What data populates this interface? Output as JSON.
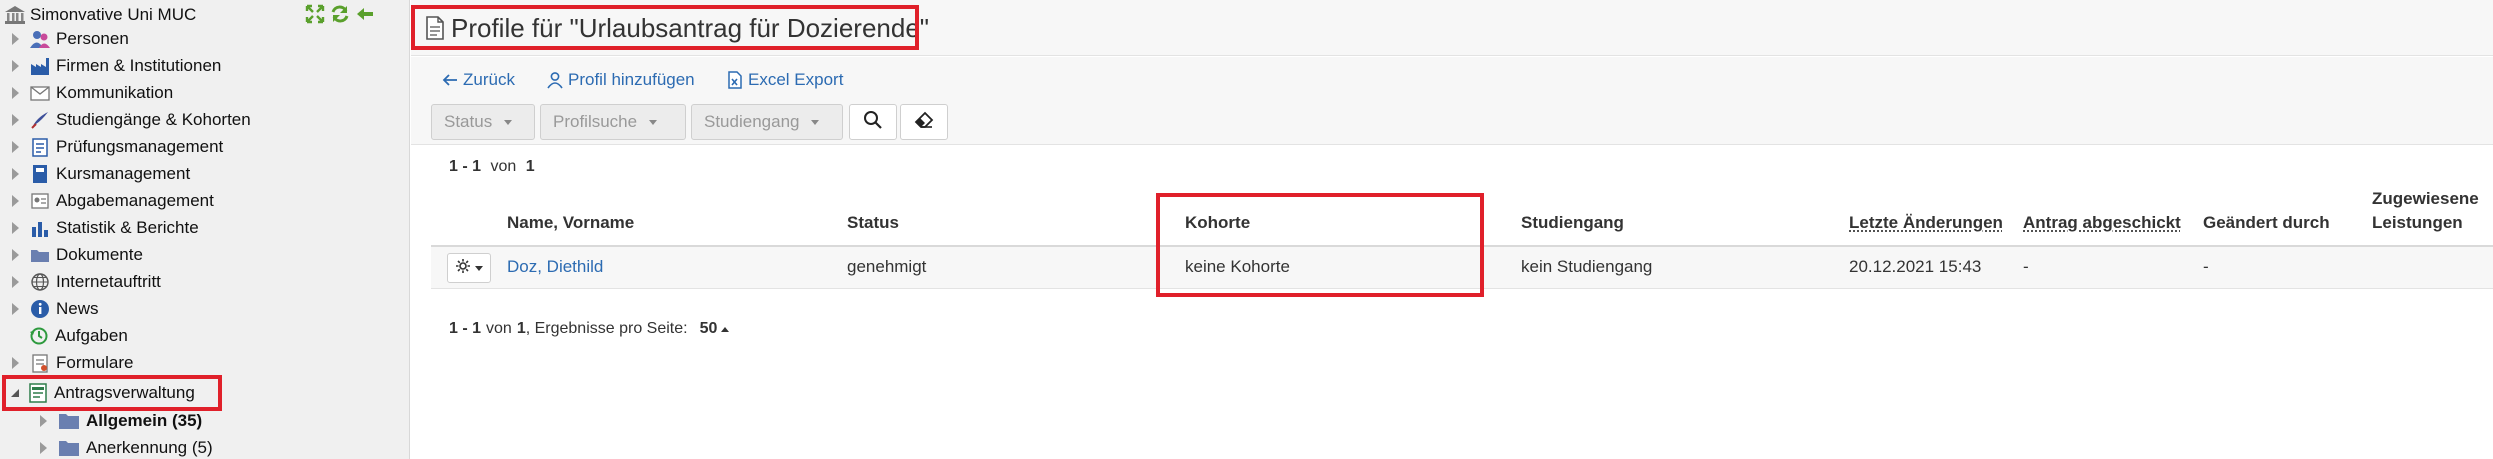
{
  "sidebar": {
    "root_label": "Simonvative Uni MUC",
    "tools": [
      {
        "icon": "expand-all-icon"
      },
      {
        "icon": "refresh-icon"
      },
      {
        "icon": "collapse-arrow-icon"
      }
    ],
    "items": [
      {
        "label": "Personen",
        "icon": "persons-icon"
      },
      {
        "label": "Firmen & Institutionen",
        "icon": "factory-icon"
      },
      {
        "label": "Kommunikation",
        "icon": "envelope-icon"
      },
      {
        "label": "Studiengänge & Kohorten",
        "icon": "graduation-icon"
      },
      {
        "label": "Prüfungsmanagement",
        "icon": "exam-icon"
      },
      {
        "label": "Kursmanagement",
        "icon": "book-icon"
      },
      {
        "label": "Abgabemanagement",
        "icon": "submission-icon"
      },
      {
        "label": "Statistik & Berichte",
        "icon": "bar-chart-icon"
      },
      {
        "label": "Dokumente",
        "icon": "folder-icon"
      },
      {
        "label": "Internetauftritt",
        "icon": "globe-icon"
      },
      {
        "label": "News",
        "icon": "info-icon"
      },
      {
        "label": "Aufgaben",
        "icon": "tasks-icon"
      },
      {
        "label": "Formulare",
        "icon": "form-icon"
      },
      {
        "label": "Antragsverwaltung",
        "icon": "application-icon"
      },
      {
        "label": "Allgemein (35)",
        "icon": "folder-icon"
      },
      {
        "label": "Anerkennung (5)",
        "icon": "folder-icon"
      }
    ]
  },
  "header": {
    "title": "Profile für \"Urlaubsantrag für Dozierende\""
  },
  "actions": {
    "back": "Zurück",
    "add_profile": "Profil hinzufügen",
    "excel_export": "Excel Export"
  },
  "filters": {
    "status": "Status",
    "profile_search": "Profilsuche",
    "study_program": "Studiengang"
  },
  "results": {
    "count_range": "1 - 1",
    "count_of": "von",
    "count_total": "1",
    "per_page_label": ", Ergebnisse pro Seite:",
    "per_page_value": "50"
  },
  "table": {
    "columns": {
      "name": "Name, Vorname",
      "status": "Status",
      "cohort": "Kohorte",
      "study_program": "Studiengang",
      "last_changes": "Letzte Änderungen",
      "submitted": "Antrag abgeschickt",
      "changed_by": "Geändert durch",
      "assigned_line1": "Zugewiesene",
      "assigned_line2": "Leistungen"
    },
    "rows": [
      {
        "name": "Doz, Diethild",
        "status": "genehmigt",
        "cohort": "keine Kohorte",
        "study_program": "kein Studiengang",
        "last_changes": "20.12.2021 15:43",
        "submitted": "-",
        "changed_by": "-",
        "assigned": ""
      }
    ]
  },
  "colors": {
    "highlight": "#e0202a",
    "link": "#2c6bb2"
  }
}
